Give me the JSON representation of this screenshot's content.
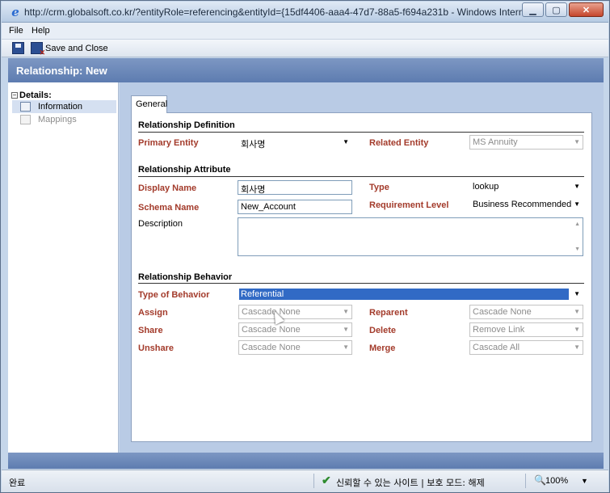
{
  "window": {
    "title": "http://crm.globalsoft.co.kr/?entityRole=referencing&entityId={15df4406-aaa4-47d7-88a5-f694a231b - Windows Internet Explo..."
  },
  "menu": {
    "file": "File",
    "help": "Help"
  },
  "toolbar": {
    "save_close_label": "Save and Close"
  },
  "header": {
    "title": "Relationship: New"
  },
  "nav": {
    "section": "Details:",
    "items": [
      {
        "label": "Information"
      },
      {
        "label": "Mappings"
      }
    ]
  },
  "tabs": {
    "general": "General"
  },
  "definition": {
    "section": "Relationship Definition",
    "primary_entity_label": "Primary Entity",
    "primary_entity_value": "회사명",
    "related_entity_label": "Related Entity",
    "related_entity_value": "MS Annuity"
  },
  "attribute": {
    "section": "Relationship Attribute",
    "display_name_label": "Display Name",
    "display_name_value": "회사명",
    "type_label": "Type",
    "type_value": "lookup",
    "schema_name_label": "Schema Name",
    "schema_name_value": "New_Account",
    "requirement_label": "Requirement Level",
    "requirement_value": "Business Recommended",
    "description_label": "Description"
  },
  "behavior": {
    "section": "Relationship Behavior",
    "type_label": "Type of Behavior",
    "type_value": "Referential",
    "assign_label": "Assign",
    "assign_value": "Cascade None",
    "reparent_label": "Reparent",
    "reparent_value": "Cascade None",
    "share_label": "Share",
    "share_value": "Cascade None",
    "delete_label": "Delete",
    "delete_value": "Remove Link",
    "unshare_label": "Unshare",
    "unshare_value": "Cascade None",
    "merge_label": "Merge",
    "merge_value": "Cascade All"
  },
  "status": {
    "left": "완료",
    "zone": "신뢰할 수 있는 사이트 | 보호 모드: 해제",
    "zoom": "100%"
  }
}
